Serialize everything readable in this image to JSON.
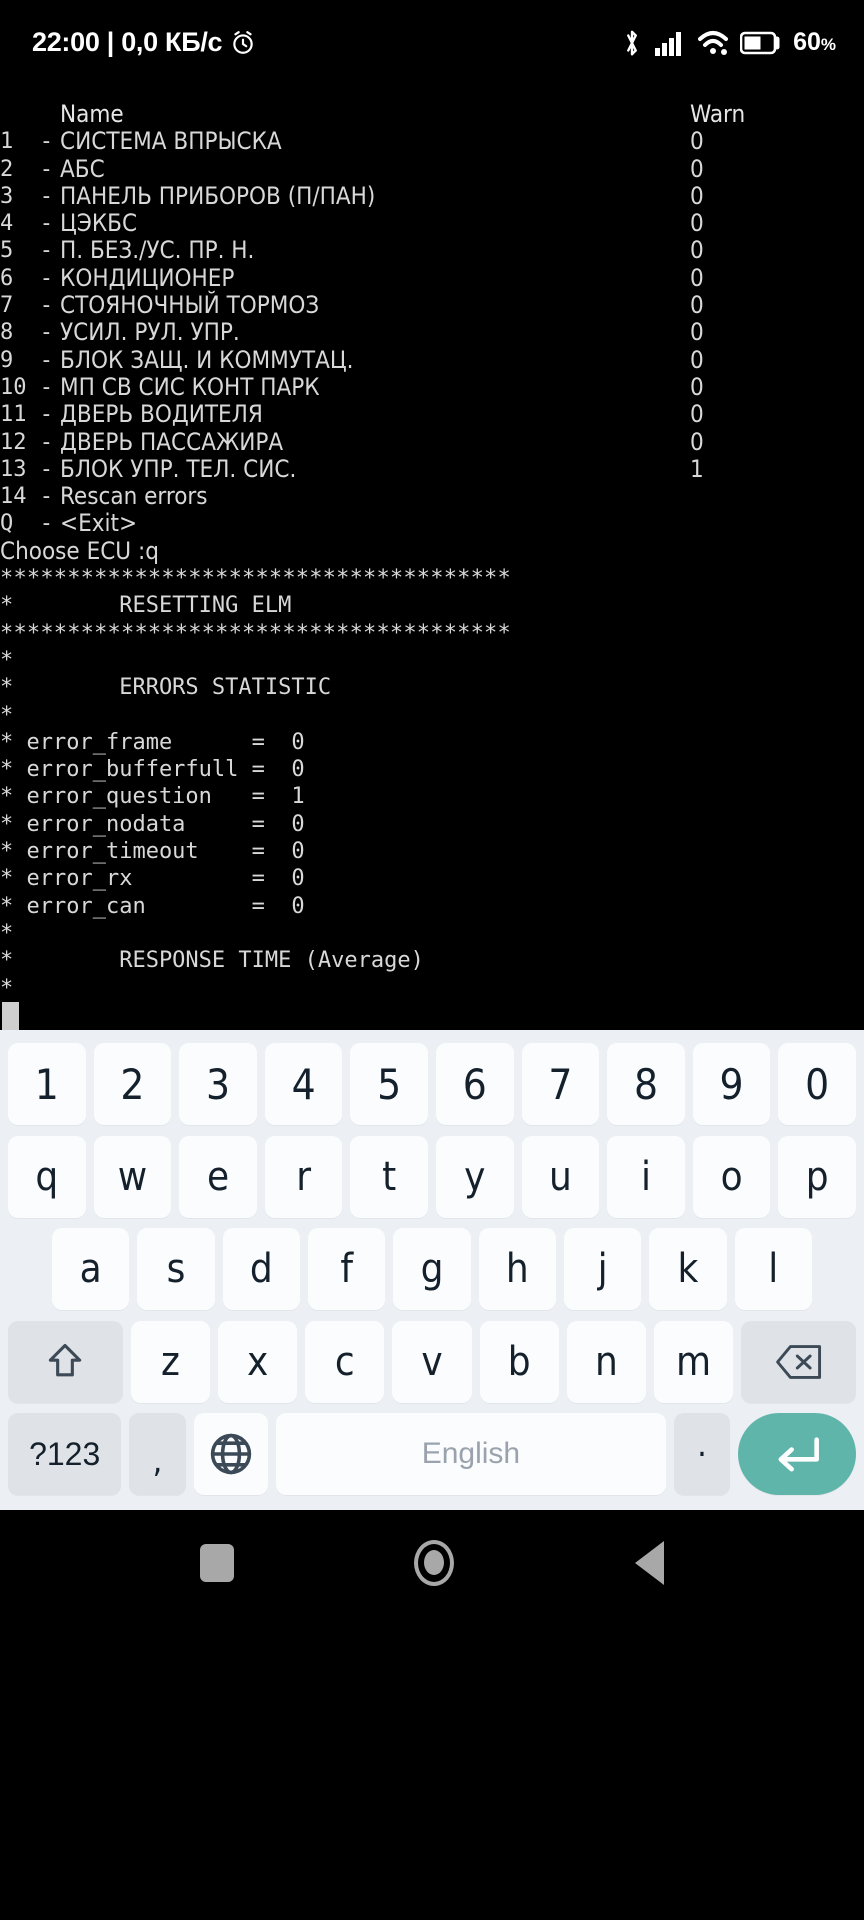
{
  "status_bar": {
    "clock": "22:00 | 0,0 КБ/с",
    "alarm_icon": "alarm-icon",
    "bluetooth_icon": "bluetooth-icon",
    "signal_icon": "cellular-signal-icon",
    "wifi_icon": "wifi-icon",
    "battery_icon": "battery-icon",
    "battery_level": "60",
    "battery_unit": "%"
  },
  "terminal": {
    "header": {
      "index": "",
      "name": "Name",
      "warn": "Warn"
    },
    "ecu_rows": [
      {
        "index": "1 ",
        "dash": "-",
        "name": "СИСТЕМА ВПРЫСКА",
        "warn": "0"
      },
      {
        "index": "2 ",
        "dash": "-",
        "name": "АБС",
        "warn": "0"
      },
      {
        "index": "3 ",
        "dash": "-",
        "name": "ПАНЕЛЬ ПРИБОРОВ (П/ПАН)",
        "warn": "0"
      },
      {
        "index": "4 ",
        "dash": "-",
        "name": "ЦЭКБС",
        "warn": "0"
      },
      {
        "index": "5 ",
        "dash": "-",
        "name": "П. БЕЗ./УС. ПР. Н.",
        "warn": "0"
      },
      {
        "index": "6 ",
        "dash": "-",
        "name": "КОНДИЦИОНЕР",
        "warn": "0"
      },
      {
        "index": "7 ",
        "dash": "-",
        "name": "СТОЯНОЧНЫЙ ТОРМОЗ",
        "warn": "0"
      },
      {
        "index": "8 ",
        "dash": "-",
        "name": "УСИЛ. РУЛ. УПР.",
        "warn": "0"
      },
      {
        "index": "9 ",
        "dash": "-",
        "name": "БЛОК ЗАЩ. И КОММУТАЦ.",
        "warn": "0"
      },
      {
        "index": "10",
        "dash": "-",
        "name": "МП СВ СИС КОНТ ПАРК",
        "warn": "0"
      },
      {
        "index": "11",
        "dash": "-",
        "name": "ДВЕРЬ ВОДИТЕЛЯ",
        "warn": "0"
      },
      {
        "index": "12",
        "dash": "-",
        "name": "ДВЕРЬ ПАССАЖИРА",
        "warn": "0"
      },
      {
        "index": "13",
        "dash": "-",
        "name": "БЛОК УПР. ТЕЛ. СИС.",
        "warn": "1"
      },
      {
        "index": "14",
        "dash": "-",
        "name": "Rescan errors",
        "warn": ""
      },
      {
        "index": "Q ",
        "dash": "-",
        "name": "<Exit>",
        "warn": ""
      }
    ],
    "prompt_line": "Choose ECU :q",
    "separator": "**************************************",
    "resetting_title": "*        RESETTING ELM",
    "separator2": "**************************************",
    "blank_star_1": "*",
    "errors_statistic_title": "*        ERRORS STATISTIC",
    "blank_star_2": "*",
    "error_stats": [
      {
        "line": "* error_frame      =  0"
      },
      {
        "line": "* error_bufferfull =  0"
      },
      {
        "line": "* error_question   =  1"
      },
      {
        "line": "* error_nodata     =  0"
      },
      {
        "line": "* error_timeout    =  0"
      },
      {
        "line": "* error_rx         =  0"
      },
      {
        "line": "* error_can        =  0"
      }
    ],
    "blank_star_3": "*",
    "response_time_title": "*        RESPONSE TIME (Average)",
    "blank_star_4": "*",
    "cursor": "block-cursor"
  },
  "keyboard": {
    "rows": {
      "numbers": [
        "1",
        "2",
        "3",
        "4",
        "5",
        "6",
        "7",
        "8",
        "9",
        "0"
      ],
      "qwerty": [
        "q",
        "w",
        "e",
        "r",
        "t",
        "y",
        "u",
        "i",
        "o",
        "p"
      ],
      "asdf": [
        "a",
        "s",
        "d",
        "f",
        "g",
        "h",
        "j",
        "k",
        "l"
      ],
      "zxcv": [
        "z",
        "x",
        "c",
        "v",
        "b",
        "n",
        "m"
      ]
    },
    "shift_key": "shift-key",
    "backspace_key": "backspace-key",
    "symbols_key": "?123",
    "comma_key": ",",
    "globe_key": "globe-key",
    "space_key": "English",
    "period_key": ".",
    "enter_key": "enter-key",
    "enter_accent_color": "#5fb5aa",
    "key_bg_color": "#fbfcfd",
    "mod_key_bg_color": "#dfe3e7",
    "keyboard_bg_color": "#eceff3"
  },
  "navbar": {
    "recents": "recents-square-icon",
    "home": "home-circle-icon",
    "back": "back-triangle-icon"
  }
}
